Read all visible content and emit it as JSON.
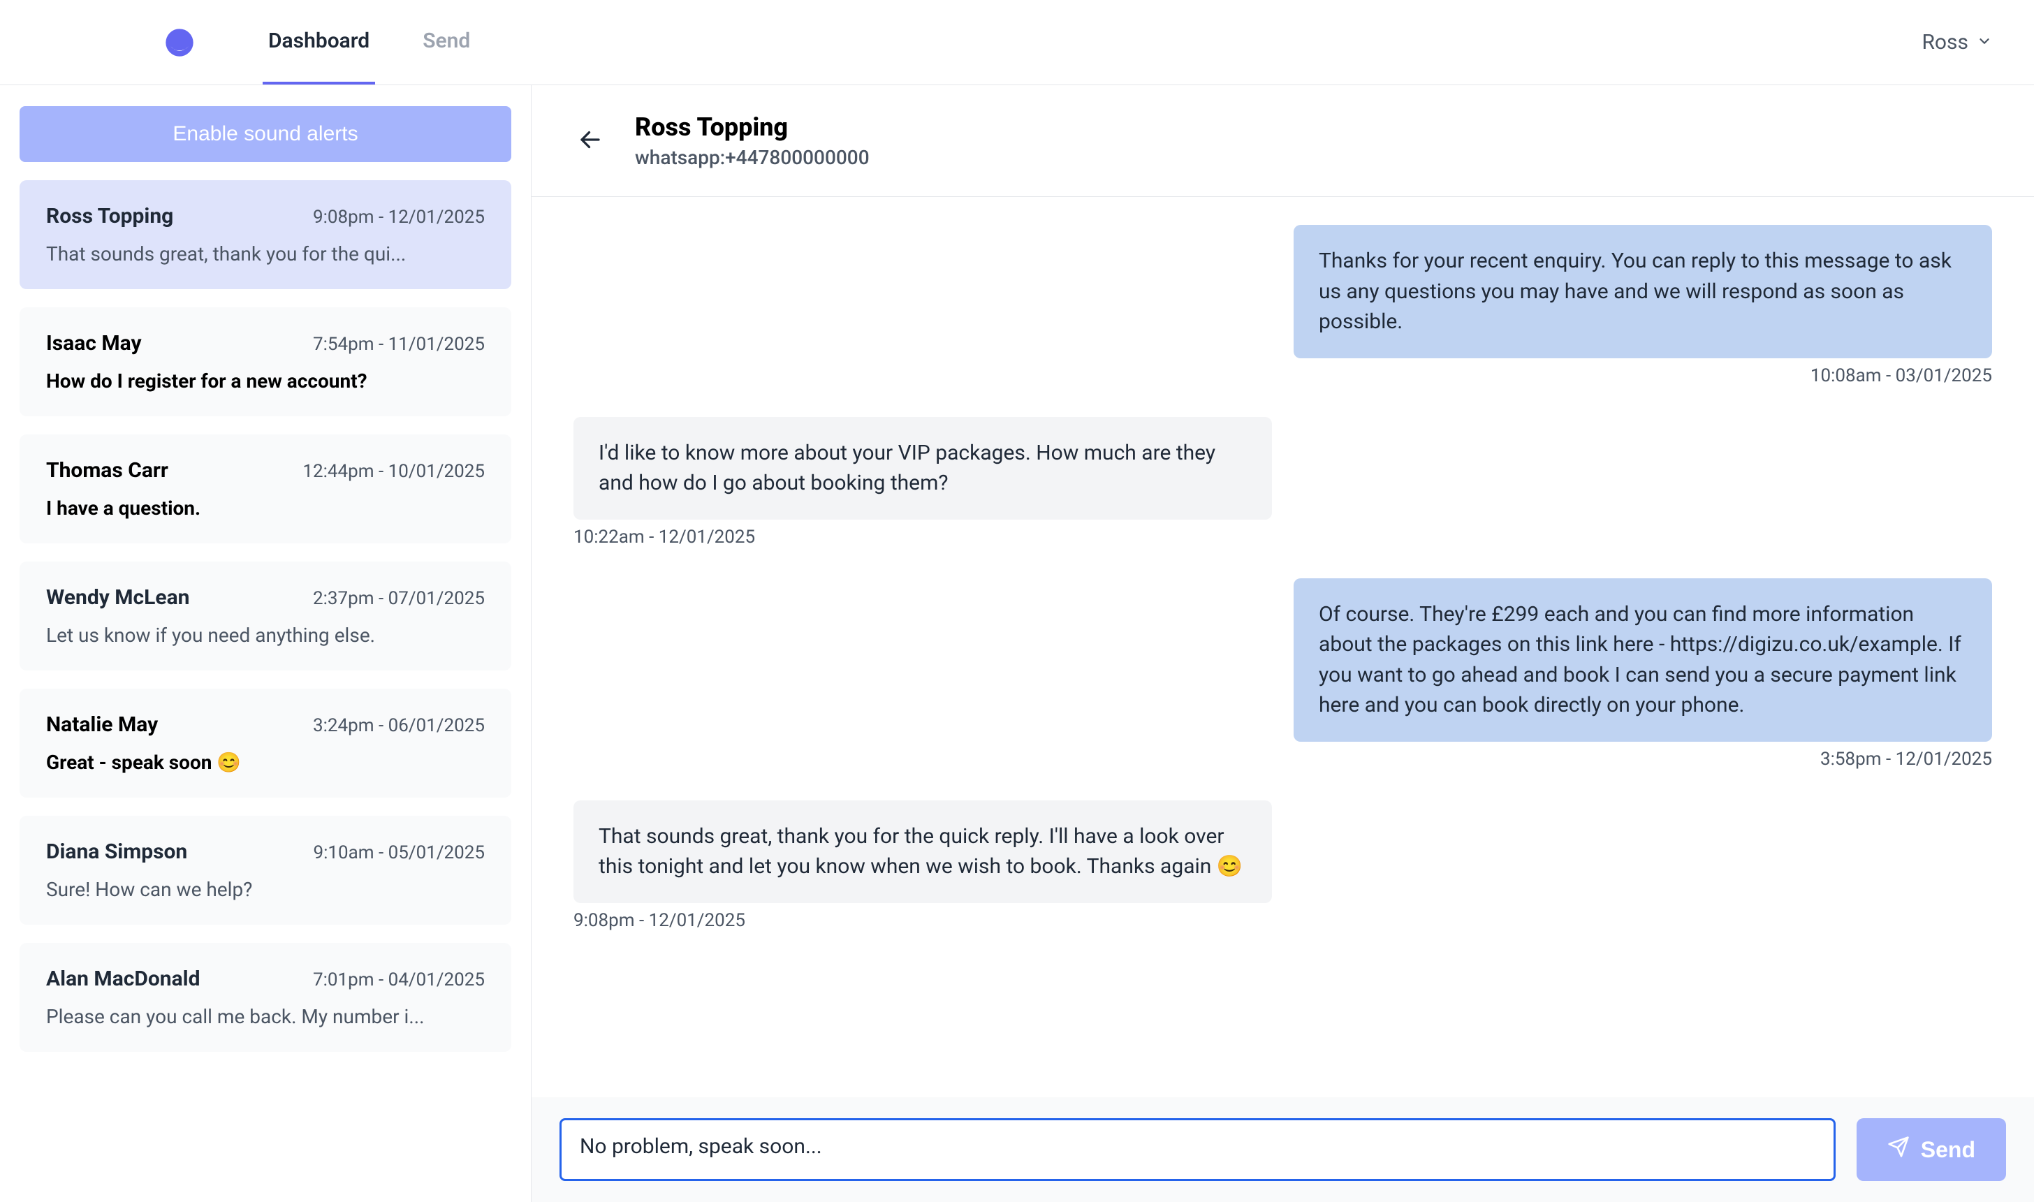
{
  "nav": {
    "tabs": {
      "dashboard": "Dashboard",
      "send": "Send"
    },
    "active_tab": "dashboard",
    "user_name": "Ross"
  },
  "sidebar": {
    "sound_alerts_label": "Enable sound alerts",
    "conversations": [
      {
        "name": "Ross Topping",
        "ts": "9:08pm - 12/01/2025",
        "preview": "That sounds great, thank you for the qui...",
        "selected": true,
        "unread": false
      },
      {
        "name": "Isaac May",
        "ts": "7:54pm - 11/01/2025",
        "preview": "How do I register for a new account?",
        "selected": false,
        "unread": true
      },
      {
        "name": "Thomas Carr",
        "ts": "12:44pm - 10/01/2025",
        "preview": "I have a question.",
        "selected": false,
        "unread": true
      },
      {
        "name": "Wendy McLean",
        "ts": "2:37pm - 07/01/2025",
        "preview": "Let us know if you need anything else.",
        "selected": false,
        "unread": false
      },
      {
        "name": "Natalie May",
        "ts": "3:24pm - 06/01/2025",
        "preview": "Great - speak soon 😊",
        "selected": false,
        "unread": true
      },
      {
        "name": "Diana Simpson",
        "ts": "9:10am - 05/01/2025",
        "preview": "Sure! How can we help?",
        "selected": false,
        "unread": false
      },
      {
        "name": "Alan MacDonald",
        "ts": "7:01pm - 04/01/2025",
        "preview": "Please can you call me back. My number i...",
        "selected": false,
        "unread": false
      }
    ]
  },
  "chat": {
    "title": "Ross Topping",
    "subtitle": "whatsapp:+447800000000",
    "messages": [
      {
        "dir": "out",
        "text": "Thanks for your recent enquiry. You can reply to this message to ask us any questions you may have and we will respond as soon as possible.",
        "ts": "10:08am - 03/01/2025"
      },
      {
        "dir": "in",
        "text": "I'd like to know more about your VIP packages. How much are they and how do I go about booking them?",
        "ts": "10:22am - 12/01/2025"
      },
      {
        "dir": "out",
        "text": "Of course. They're £299 each and you can find more information about the packages on this link here - https://digizu.co.uk/example. If you want to go ahead and book I can send you a secure payment link here and you can book directly on your phone.",
        "ts": "3:58pm - 12/01/2025"
      },
      {
        "dir": "in",
        "text": "That sounds great, thank you for the quick reply. I'll have a look over this tonight and let you know when we wish to book. Thanks again 😊",
        "ts": "9:08pm - 12/01/2025"
      }
    ],
    "composer": {
      "value": "No problem, speak soon...",
      "send_label": "Send"
    }
  }
}
